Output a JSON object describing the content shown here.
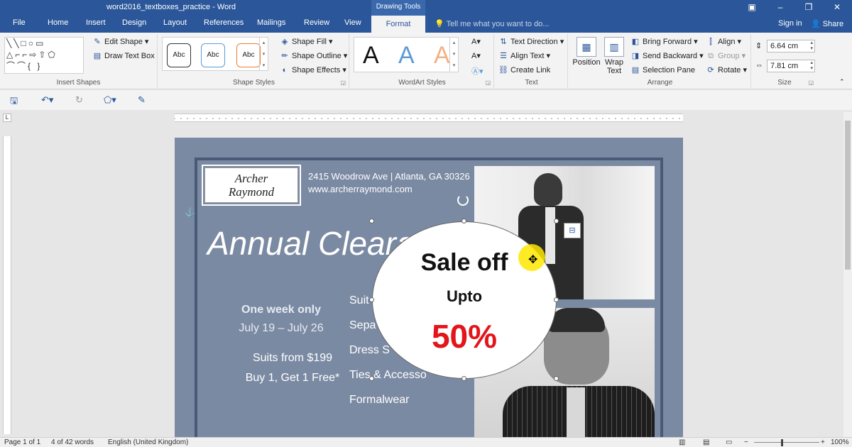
{
  "window": {
    "title": "word2016_textboxes_practice - Word",
    "context_tab_group": "Drawing Tools"
  },
  "tabs": [
    "File",
    "Home",
    "Insert",
    "Design",
    "Layout",
    "References",
    "Mailings",
    "Review",
    "View"
  ],
  "active_tab": "Format",
  "tell_me": "Tell me what you want to do...",
  "account": {
    "signin": "Sign in",
    "share": "Share"
  },
  "ribbon": {
    "insert_shapes": {
      "label": "Insert Shapes",
      "edit_shape": "Edit Shape",
      "draw_text_box": "Draw Text Box"
    },
    "shape_styles": {
      "label": "Shape Styles",
      "sample": "Abc",
      "fill": "Shape Fill",
      "outline": "Shape Outline",
      "effects": "Shape Effects"
    },
    "wordart_styles": {
      "label": "WordArt Styles",
      "letter": "A"
    },
    "text": {
      "label": "Text",
      "direction": "Text Direction",
      "align": "Align Text",
      "link": "Create Link"
    },
    "arrange": {
      "label": "Arrange",
      "position": "Position",
      "wrap_text": "Wrap Text",
      "bring_forward": "Bring Forward",
      "send_backward": "Send Backward",
      "selection_pane": "Selection Pane",
      "align": "Align",
      "group": "Group",
      "rotate": "Rotate"
    },
    "size": {
      "label": "Size",
      "height": "6.64 cm",
      "width": "7.81 cm"
    }
  },
  "document": {
    "logo_line1": "Archer",
    "logo_line2": "Raymond",
    "address": "2415 Woodrow Ave | Atlanta, GA 30326",
    "website": "www.archerraymond.com",
    "headline": "Annual Cleara",
    "one_week": "One week only",
    "dates": "July 19 – July 26",
    "suits_from": "Suits from $199",
    "buy_offer": "Buy 1, Get 1 Free*",
    "categories": [
      "Suit",
      "Sepa",
      "Dress S",
      "Ties & Accesso",
      "Formalwear"
    ],
    "shape": {
      "line1": "Sale off",
      "line2": "Upto",
      "line3": "50%"
    }
  },
  "colors": {
    "brand": "#2b579a",
    "page_bg": "#7b8aa3",
    "frame": "#485a76",
    "sale_red": "#e4141b"
  },
  "status": {
    "page": "Page 1 of 1",
    "words": "4 of 42 words",
    "language": "English (United Kingdom)",
    "zoom": "100%"
  }
}
